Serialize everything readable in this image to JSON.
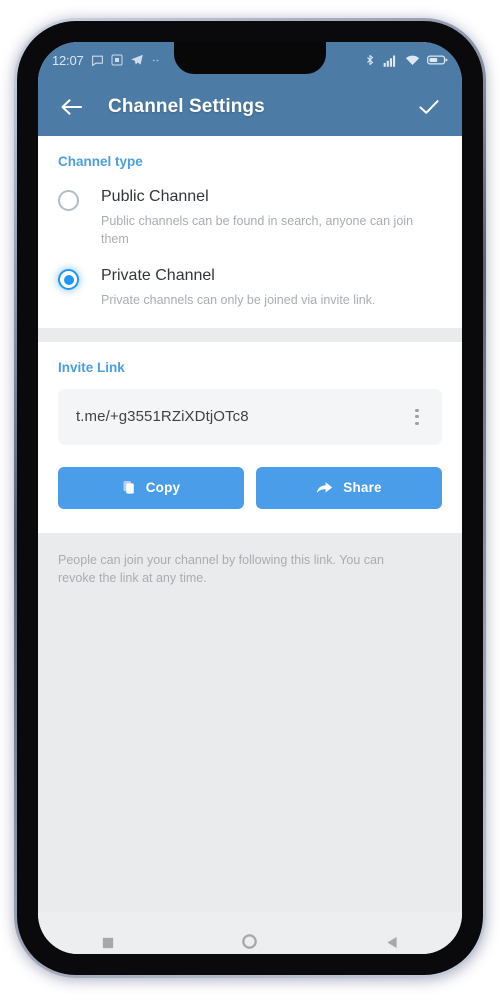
{
  "status_bar": {
    "time": "12:07",
    "left_icons": [
      "message-icon",
      "app-notification-icon",
      "telegram-icon",
      "more-notifications-icon"
    ],
    "right_icons": [
      "bluetooth-icon",
      "cellular-signal-icon",
      "wifi-icon",
      "battery-icon"
    ]
  },
  "app_bar": {
    "back_icon": "back-arrow-icon",
    "title": "Channel Settings",
    "done_icon": "checkmark-icon"
  },
  "channel_type": {
    "header": "Channel type",
    "options": [
      {
        "id": "public",
        "title": "Public Channel",
        "description": "Public channels can be found in search, anyone can join them",
        "selected": false
      },
      {
        "id": "private",
        "title": "Private Channel",
        "description": "Private channels can only be joined via invite link.",
        "selected": true
      }
    ]
  },
  "invite_link": {
    "header": "Invite Link",
    "url": "t.me/+g3551RZiXDtjOTc8",
    "menu_icon": "overflow-menu-icon",
    "buttons": [
      {
        "id": "copy",
        "label": "Copy",
        "icon": "copy-icon"
      },
      {
        "id": "share",
        "label": "Share",
        "icon": "share-arrow-icon"
      }
    ],
    "footer_note": "People can join your channel by following this link. You can revoke the link at any time."
  },
  "nav_bar": {
    "items": [
      "recents-square-icon",
      "home-circle-icon",
      "back-triangle-icon"
    ]
  },
  "colors": {
    "status_bar": "#4c7ba5",
    "app_bar": "#4c7ba5",
    "accent_link": "#4a9fe0",
    "accent_button": "#4a9de8",
    "radio_selected": "#2196f3",
    "page_background": "#e9ebed"
  }
}
